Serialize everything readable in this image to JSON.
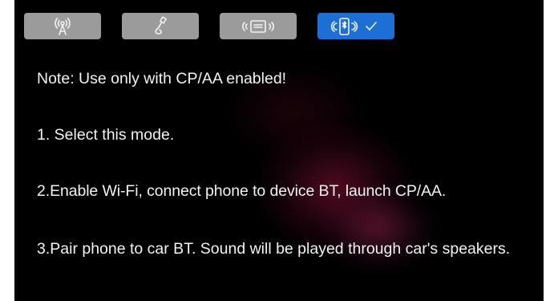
{
  "modes": [
    {
      "icon": "antenna-icon",
      "active": false
    },
    {
      "icon": "usb-cable-icon",
      "active": false
    },
    {
      "icon": "wireless-card-icon",
      "active": false
    },
    {
      "icon": "bluetooth-phone-icon",
      "active": true,
      "checked": true
    }
  ],
  "colors": {
    "active": "#1d6fd6",
    "inactive": "#9b9b9b",
    "background": "#000000",
    "text": "#f2f2f2"
  },
  "instructions": {
    "note": "Note: Use only with CP/AA enabled!",
    "step1": "1. Select this mode.",
    "step2": "2.Enable Wi-Fi, connect phone to device BT, launch CP/AA.",
    "step3": "3.Pair phone to car BT. Sound will be played through car's speakers."
  }
}
